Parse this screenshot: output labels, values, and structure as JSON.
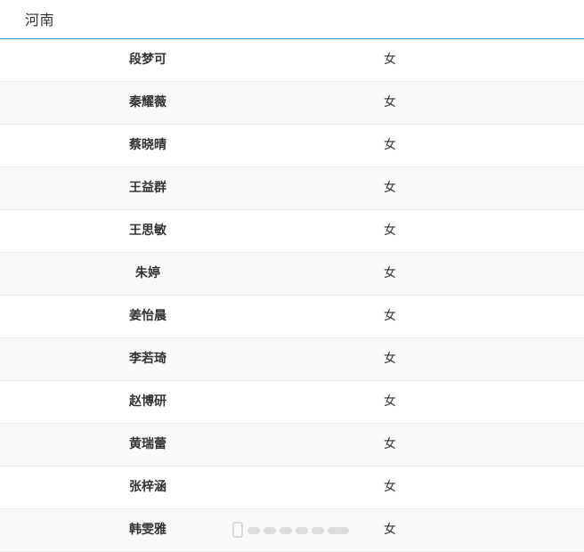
{
  "header": {
    "title": "河南"
  },
  "table": {
    "rows": [
      {
        "name": "段梦可",
        "gender": "女"
      },
      {
        "name": "秦耀薇",
        "gender": "女"
      },
      {
        "name": "蔡晓晴",
        "gender": "女"
      },
      {
        "name": "王益群",
        "gender": "女"
      },
      {
        "name": "王思敏",
        "gender": "女"
      },
      {
        "name": "朱婷",
        "gender": "女"
      },
      {
        "name": "姜怡晨",
        "gender": "女"
      },
      {
        "name": "李若琦",
        "gender": "女"
      },
      {
        "name": "赵博研",
        "gender": "女"
      },
      {
        "name": "黄瑞蕾",
        "gender": "女"
      },
      {
        "name": "张梓涵",
        "gender": "女"
      },
      {
        "name": "韩雯雅",
        "gender": "女"
      }
    ]
  },
  "colors": {
    "header_border": "#3d8fc9",
    "row_alt_bg": "#f9f9f9",
    "text": "#333333"
  }
}
